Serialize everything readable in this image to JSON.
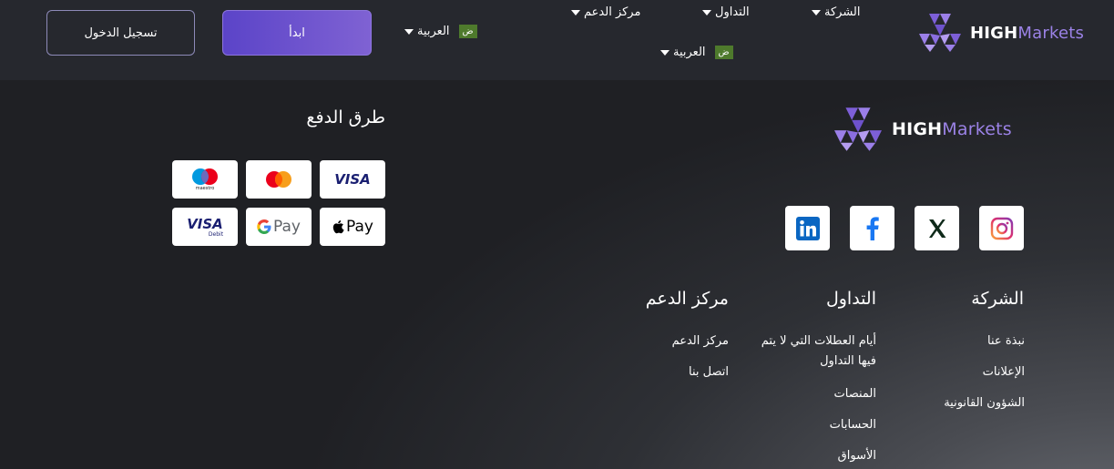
{
  "brand": {
    "high": "HIGH",
    "markets": "Markets"
  },
  "header": {
    "nav": [
      {
        "label": "الشركة"
      },
      {
        "label": "التداول"
      },
      {
        "label": "مركز الدعم"
      }
    ],
    "language": {
      "label": "العربية",
      "badge": "ض"
    },
    "start_button": "ابدأ",
    "login_button": "تسجيل الدخول"
  },
  "footer": {
    "social": [
      {
        "icon": "instagram-icon"
      },
      {
        "icon": "x-icon"
      },
      {
        "icon": "facebook-icon"
      },
      {
        "icon": "linkedin-icon"
      }
    ],
    "payment_title": "طرق الدفع",
    "payments": [
      {
        "label": "VISA",
        "icon": "visa-icon"
      },
      {
        "label": "",
        "icon": "mastercard-icon"
      },
      {
        "label": "maestro",
        "icon": "maestro-icon"
      },
      {
        "label": "Pay",
        "icon": "apple-pay-icon"
      },
      {
        "label": "Pay",
        "icon": "google-pay-icon"
      },
      {
        "label": "VISA",
        "sub": "Debit",
        "icon": "visa-debit-icon"
      }
    ],
    "columns": [
      {
        "title": "الشركة",
        "links": [
          "نبذة عنا",
          "الإعلانات",
          "الشؤون القانونية"
        ]
      },
      {
        "title": "التداول",
        "links": [
          "أيام العطلات التي لا يتم فيها التداول",
          "المنصات",
          "الحسابات",
          "الأسواق"
        ]
      },
      {
        "title": "مركز الدعم",
        "links": [
          "مركز الدعم",
          "اتصل بنا"
        ]
      }
    ]
  }
}
